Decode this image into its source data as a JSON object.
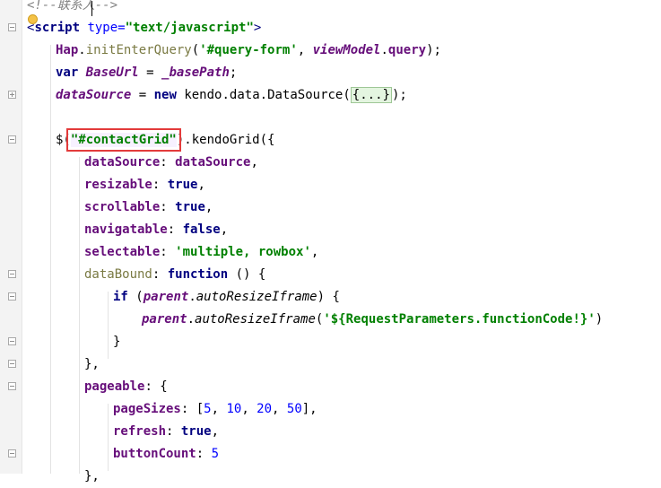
{
  "editor": {
    "lines": [
      {
        "indent": 0,
        "tokens": [
          {
            "t": "<!--联系人-->",
            "c": "cm"
          }
        ]
      },
      {
        "indent": 0,
        "tokens": [
          {
            "t": "<",
            "c": "tg"
          },
          {
            "t": "script",
            "c": "tgb"
          },
          {
            "t": " type=",
            "c": "at"
          },
          {
            "t": "\"text/javascript\"",
            "c": "st"
          },
          {
            "t": ">",
            "c": "tg"
          }
        ]
      },
      {
        "indent": 1,
        "tokens": [
          {
            "t": "Hap",
            "c": "pr"
          },
          {
            "t": ".",
            "c": "tx"
          },
          {
            "t": "initEnterQuery",
            "c": "fn"
          },
          {
            "t": "(",
            "c": "tx"
          },
          {
            "t": "'#query-form'",
            "c": "st"
          },
          {
            "t": ", ",
            "c": "tx"
          },
          {
            "t": "viewModel",
            "c": "gv"
          },
          {
            "t": ".",
            "c": "tx"
          },
          {
            "t": "query",
            "c": "pr"
          },
          {
            "t": ");",
            "c": "tx"
          }
        ]
      },
      {
        "indent": 1,
        "tokens": [
          {
            "t": "var ",
            "c": "kw"
          },
          {
            "t": "BaseUrl",
            "c": "gv"
          },
          {
            "t": " = ",
            "c": "tx"
          },
          {
            "t": "_basePath",
            "c": "gv"
          },
          {
            "t": ";",
            "c": "tx"
          }
        ]
      },
      {
        "indent": 1,
        "tokens": [
          {
            "t": "dataSource",
            "c": "gv"
          },
          {
            "t": " = ",
            "c": "tx"
          },
          {
            "t": "new ",
            "c": "kw"
          },
          {
            "t": "kendo",
            "c": "tx"
          },
          {
            "t": ".",
            "c": "tx"
          },
          {
            "t": "data",
            "c": "tx"
          },
          {
            "t": ".",
            "c": "tx"
          },
          {
            "t": "DataSource",
            "c": "tx"
          },
          {
            "t": "(",
            "c": "tx"
          },
          {
            "t": "{...}",
            "c": "fold"
          },
          {
            "t": ");",
            "c": "tx"
          }
        ]
      },
      {
        "indent": 0,
        "tokens": []
      },
      {
        "indent": 1,
        "tokens": [
          {
            "t": "$(",
            "c": "tx"
          },
          {
            "t": "\"#contactGrid\"",
            "c": "hl"
          },
          {
            "t": ").",
            "c": "tx"
          },
          {
            "t": "kendoGrid",
            "c": "tx"
          },
          {
            "t": "({",
            "c": "tx"
          }
        ]
      },
      {
        "indent": 2,
        "tokens": [
          {
            "t": "dataSource",
            "c": "pr"
          },
          {
            "t": ": ",
            "c": "tx"
          },
          {
            "t": "dataSource",
            "c": "pr"
          },
          {
            "t": ",",
            "c": "tx"
          }
        ]
      },
      {
        "indent": 2,
        "tokens": [
          {
            "t": "resizable",
            "c": "pr"
          },
          {
            "t": ": ",
            "c": "tx"
          },
          {
            "t": "true",
            "c": "kw"
          },
          {
            "t": ",",
            "c": "tx"
          }
        ]
      },
      {
        "indent": 2,
        "tokens": [
          {
            "t": "scrollable",
            "c": "pr"
          },
          {
            "t": ": ",
            "c": "tx"
          },
          {
            "t": "true",
            "c": "kw"
          },
          {
            "t": ",",
            "c": "tx"
          }
        ]
      },
      {
        "indent": 2,
        "tokens": [
          {
            "t": "navigatable",
            "c": "pr"
          },
          {
            "t": ": ",
            "c": "tx"
          },
          {
            "t": "false",
            "c": "kw"
          },
          {
            "t": ",",
            "c": "tx"
          }
        ]
      },
      {
        "indent": 2,
        "tokens": [
          {
            "t": "selectable",
            "c": "pr"
          },
          {
            "t": ": ",
            "c": "tx"
          },
          {
            "t": "'multiple, rowbox'",
            "c": "st"
          },
          {
            "t": ",",
            "c": "tx"
          }
        ]
      },
      {
        "indent": 2,
        "tokens": [
          {
            "t": "dataBound",
            "c": "wk"
          },
          {
            "t": ": ",
            "c": "tx"
          },
          {
            "t": "function",
            "c": "kw"
          },
          {
            "t": " () {",
            "c": "tx"
          }
        ]
      },
      {
        "indent": 3,
        "tokens": [
          {
            "t": "if ",
            "c": "kw"
          },
          {
            "t": "(",
            "c": "tx"
          },
          {
            "t": "parent",
            "c": "gv"
          },
          {
            "t": ".",
            "c": "tx"
          },
          {
            "t": "autoResizeIframe",
            "c": "ital"
          },
          {
            "t": ") {",
            "c": "tx"
          }
        ]
      },
      {
        "indent": 4,
        "tokens": [
          {
            "t": "parent",
            "c": "gv"
          },
          {
            "t": ".",
            "c": "tx"
          },
          {
            "t": "autoResizeIframe",
            "c": "ital"
          },
          {
            "t": "(",
            "c": "tx"
          },
          {
            "t": "'${RequestParameters.functionCode!}'",
            "c": "st"
          },
          {
            "t": ")",
            "c": "tx"
          }
        ]
      },
      {
        "indent": 3,
        "tokens": [
          {
            "t": "}",
            "c": "tx"
          }
        ]
      },
      {
        "indent": 2,
        "tokens": [
          {
            "t": "},",
            "c": "tx"
          }
        ]
      },
      {
        "indent": 2,
        "tokens": [
          {
            "t": "pageable",
            "c": "pr"
          },
          {
            "t": ": {",
            "c": "tx"
          }
        ]
      },
      {
        "indent": 3,
        "tokens": [
          {
            "t": "pageSizes",
            "c": "pr"
          },
          {
            "t": ": [",
            "c": "tx"
          },
          {
            "t": "5",
            "c": "nm"
          },
          {
            "t": ", ",
            "c": "tx"
          },
          {
            "t": "10",
            "c": "nm"
          },
          {
            "t": ", ",
            "c": "tx"
          },
          {
            "t": "20",
            "c": "nm"
          },
          {
            "t": ", ",
            "c": "tx"
          },
          {
            "t": "50",
            "c": "nm"
          },
          {
            "t": "],",
            "c": "tx"
          }
        ]
      },
      {
        "indent": 3,
        "tokens": [
          {
            "t": "refresh",
            "c": "pr"
          },
          {
            "t": ": ",
            "c": "tx"
          },
          {
            "t": "true",
            "c": "kw"
          },
          {
            "t": ",",
            "c": "tx"
          }
        ]
      },
      {
        "indent": 3,
        "tokens": [
          {
            "t": "buttonCount",
            "c": "pr"
          },
          {
            "t": ": ",
            "c": "tx"
          },
          {
            "t": "5",
            "c": "nm"
          }
        ]
      },
      {
        "indent": 2,
        "tokens": [
          {
            "t": "},",
            "c": "tx"
          }
        ]
      }
    ]
  }
}
